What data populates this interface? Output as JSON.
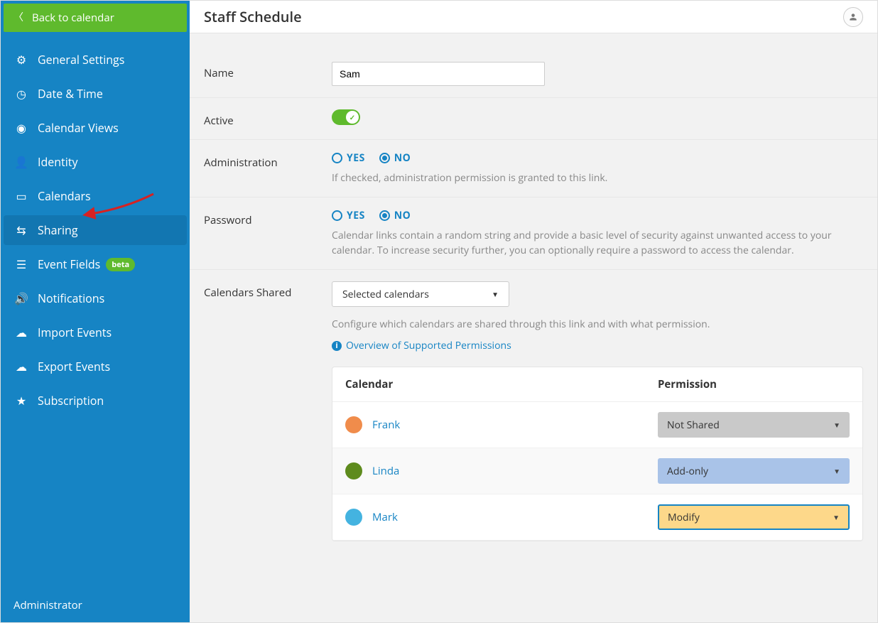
{
  "sidebar": {
    "back_label": "Back to calendar",
    "items": [
      {
        "icon": "gear-icon",
        "glyph": "⚙",
        "label": "General Settings"
      },
      {
        "icon": "clock-icon",
        "glyph": "◷",
        "label": "Date & Time"
      },
      {
        "icon": "eye-icon",
        "glyph": "◉",
        "label": "Calendar Views"
      },
      {
        "icon": "person-icon",
        "glyph": "👤",
        "label": "Identity"
      },
      {
        "icon": "calendar-icon",
        "glyph": "▭",
        "label": "Calendars"
      },
      {
        "icon": "share-icon",
        "glyph": "⇆",
        "label": "Sharing",
        "active": true
      },
      {
        "icon": "list-icon",
        "glyph": "☰",
        "label": "Event Fields",
        "badge": "beta"
      },
      {
        "icon": "sound-icon",
        "glyph": "🔊",
        "label": "Notifications"
      },
      {
        "icon": "cloud-up-icon",
        "glyph": "☁",
        "label": "Import Events"
      },
      {
        "icon": "cloud-down-icon",
        "glyph": "☁",
        "label": "Export Events"
      },
      {
        "icon": "star-icon",
        "glyph": "★",
        "label": "Subscription"
      }
    ],
    "footer": "Administrator"
  },
  "header": {
    "title": "Staff Schedule"
  },
  "form": {
    "name": {
      "label": "Name",
      "value": "Sam"
    },
    "active": {
      "label": "Active",
      "on": true
    },
    "admin": {
      "label": "Administration",
      "yes": "YES",
      "no": "NO",
      "selected": "NO",
      "help": "If checked, administration permission is granted to this link."
    },
    "password": {
      "label": "Password",
      "yes": "YES",
      "no": "NO",
      "selected": "NO",
      "help": "Calendar links contain a random string and provide a basic level of security against unwanted access to your calendar. To increase security further, you can optionally require a password to access the calendar."
    },
    "shared": {
      "label": "Calendars Shared",
      "select_value": "Selected calendars",
      "help": "Configure which calendars are shared through this link and with what permission.",
      "link_text": "Overview of Supported Permissions",
      "table": {
        "head_calendar": "Calendar",
        "head_permission": "Permission",
        "rows": [
          {
            "color": "#f08c4b",
            "name": "Frank",
            "perm": "Not Shared",
            "style": "notshared"
          },
          {
            "color": "#5e8b1d",
            "name": "Linda",
            "perm": "Add-only",
            "style": "addonly"
          },
          {
            "color": "#44b3e0",
            "name": "Mark",
            "perm": "Modify",
            "style": "modify"
          }
        ]
      }
    }
  }
}
